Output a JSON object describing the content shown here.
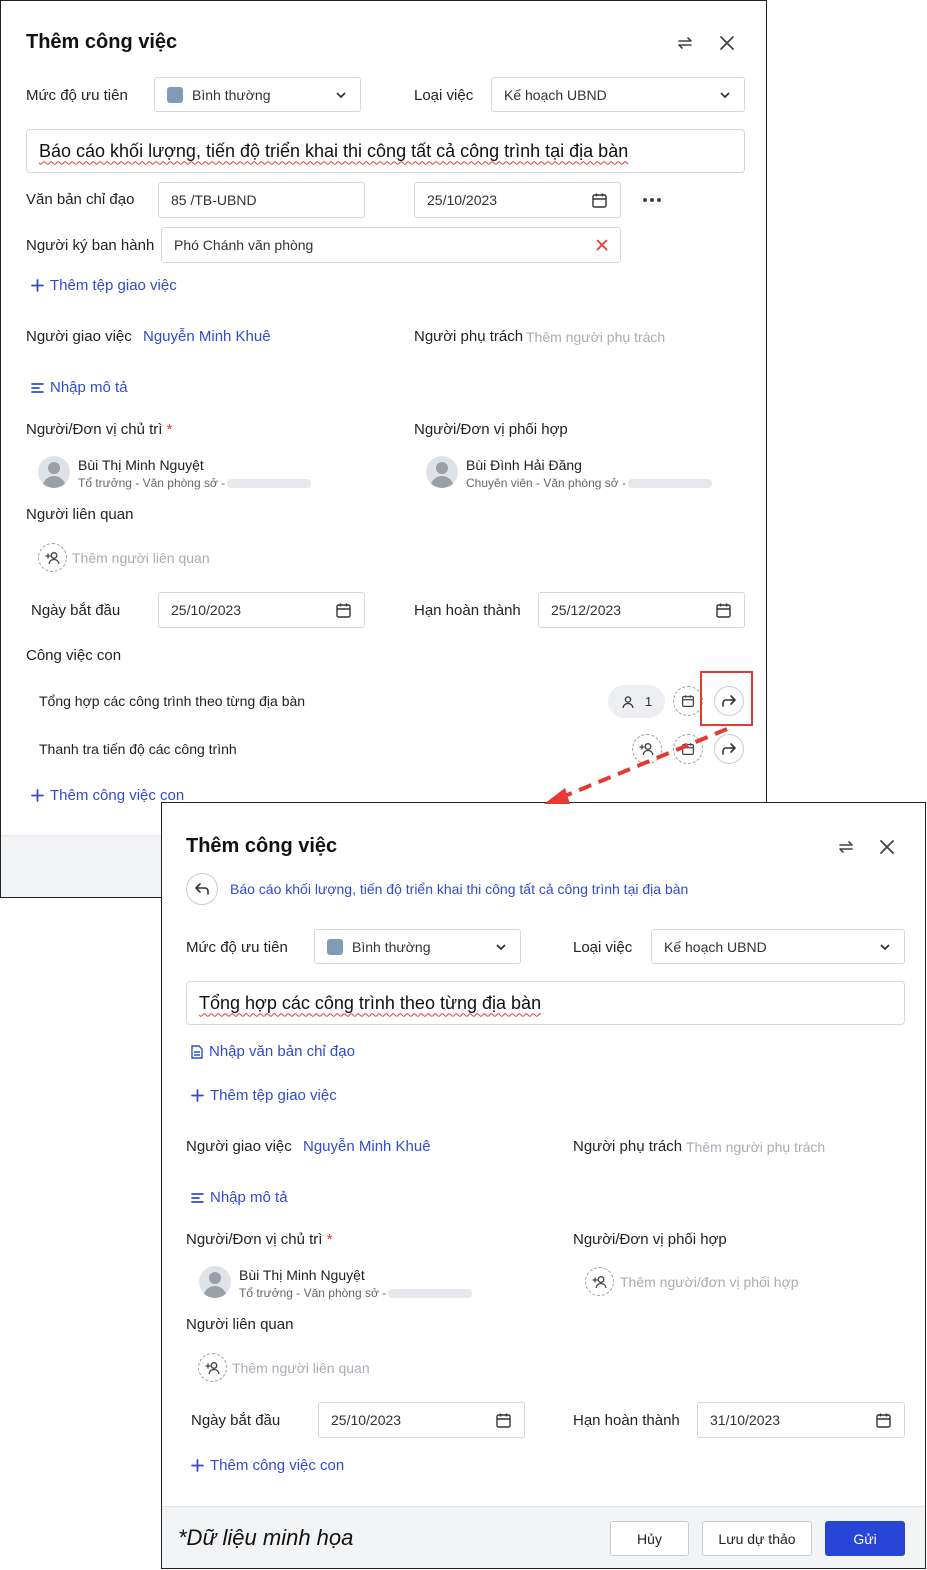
{
  "main": {
    "title": "Thêm công việc",
    "priority_label": "Mức độ ưu tiên",
    "priority_value": "Bình thường",
    "type_label": "Loại việc",
    "type_value": "Kế hoạch UBND",
    "task_title": "Báo cáo khối lượng, tiến độ triển khai thi công tất cả công trình tại địa bàn",
    "doc_label": "Văn bản chỉ đạo",
    "doc_number": "85 /TB-UBND",
    "doc_date": "25/10/2023",
    "signer_label": "Người ký ban hành",
    "signer_value": "Phó Chánh văn phòng",
    "add_file": "Thêm tệp giao việc",
    "assigner_label": "Người giao việc",
    "assigner_value": "Nguyễn Minh Khuê",
    "owner_label": "Người phụ trách",
    "owner_placeholder": "Thêm người phụ trách",
    "desc_link": "Nhập mô tả",
    "lead_label": "Người/Đơn vị chủ trì",
    "lead_name": "Bùi Thị Minh Nguyệt",
    "lead_role": "Tổ trưởng - Văn phòng sở -",
    "coop_label": "Người/Đơn vị phối hợp",
    "coop_name": "Bùi Đình Hải Đăng",
    "coop_role": "Chuyên viên - Văn phòng sở -",
    "related_label": "Người liên quan",
    "related_placeholder": "Thêm người liên quan",
    "start_label": "Ngày bắt đầu",
    "start_value": "25/10/2023",
    "due_label": "Hạn hoàn thành",
    "due_value": "25/12/2023",
    "sub_label": "Công việc con",
    "subtasks": [
      {
        "title": "Tổng hợp các công trình theo từng địa bàn",
        "count": "1"
      },
      {
        "title": "Thanh tra tiến độ các công trình"
      }
    ],
    "add_sub": "Thêm công việc con"
  },
  "sub": {
    "title": "Thêm công việc",
    "parent": "Báo cáo khối lượng, tiến độ triển khai thi công tất cả công trình tại địa bàn",
    "priority_label": "Mức độ ưu tiên",
    "priority_value": "Bình thường",
    "type_label": "Loại việc",
    "type_value": "Kế hoạch UBND",
    "task_title": "Tổng hợp các công trình theo từng địa bàn",
    "doc_link": "Nhập văn bản chỉ đạo",
    "add_file": "Thêm tệp giao việc",
    "assigner_label": "Người giao việc",
    "assigner_value": "Nguyễn Minh Khuê",
    "owner_label": "Người phụ trách",
    "owner_placeholder": "Thêm người phụ trách",
    "desc_link": "Nhập mô tả",
    "lead_label": "Người/Đơn vị chủ trì",
    "lead_name": "Bùi Thị Minh Nguyệt",
    "lead_role": "Tổ trưởng - Văn phòng sở -",
    "coop_label": "Người/Đơn vị phối hợp",
    "coop_placeholder": "Thêm người/đơn vị phối hợp",
    "related_label": "Người liên quan",
    "related_placeholder": "Thêm người liên quan",
    "start_label": "Ngày bắt đầu",
    "start_value": "25/10/2023",
    "due_label": "Hạn hoàn thành",
    "due_value": "31/10/2023",
    "add_sub": "Thêm công việc con",
    "cancel": "Hủy",
    "draft": "Lưu dự thảo",
    "send": "Gửi",
    "footnote": "*Dữ liệu minh họa"
  },
  "colors": {
    "accent": "#2f4bd3",
    "primary_button": "#2746d8",
    "highlight": "#e53935",
    "priority_swatch": "#7f9bb5"
  },
  "icons": [
    "swap-icon",
    "close-icon",
    "chevron-down-icon",
    "calendar-icon",
    "more-icon",
    "plus-icon",
    "lines-icon",
    "document-icon",
    "avatar-icon",
    "add-person-icon",
    "person-icon",
    "forward-arrow-icon",
    "back-arrow-icon"
  ]
}
